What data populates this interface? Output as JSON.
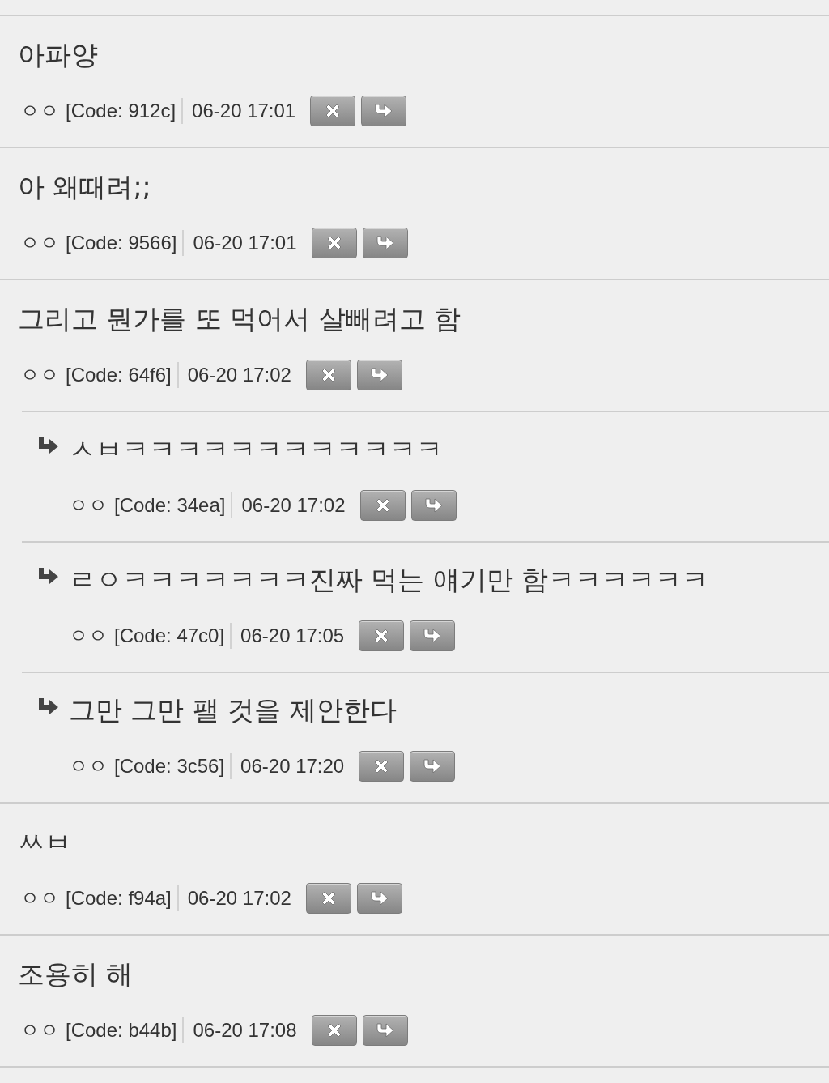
{
  "comments": [
    {
      "text": "아파양",
      "author": "ㅇㅇ",
      "code": "[Code: 912c]",
      "time": "06-20 17:01"
    },
    {
      "text": "아 왜때려;;",
      "author": "ㅇㅇ",
      "code": "[Code: 9566]",
      "time": "06-20 17:01"
    },
    {
      "text": "그리고 뭔가를 또 먹어서 살빼려고 함",
      "author": "ㅇㅇ",
      "code": "[Code: 64f6]",
      "time": "06-20 17:02",
      "replies": [
        {
          "text": "ㅅㅂㅋㅋㅋㅋㅋㅋㅋㅋㅋㅋㅋㅋ",
          "author": "ㅇㅇ",
          "code": "[Code: 34ea]",
          "time": "06-20 17:02"
        },
        {
          "text": "ㄹㅇㅋㅋㅋㅋㅋㅋㅋ진짜 먹는 얘기만 함ㅋㅋㅋㅋㅋㅋ",
          "author": "ㅇㅇ",
          "code": "[Code: 47c0]",
          "time": "06-20 17:05"
        },
        {
          "text": "그만 그만 팰 것을 제안한다",
          "author": "ㅇㅇ",
          "code": "[Code: 3c56]",
          "time": "06-20 17:20"
        }
      ]
    },
    {
      "text": "ㅆㅂ",
      "author": "ㅇㅇ",
      "code": "[Code: f94a]",
      "time": "06-20 17:02"
    },
    {
      "text": "조용히 해",
      "author": "ㅇㅇ",
      "code": "[Code: b44b]",
      "time": "06-20 17:08"
    }
  ]
}
